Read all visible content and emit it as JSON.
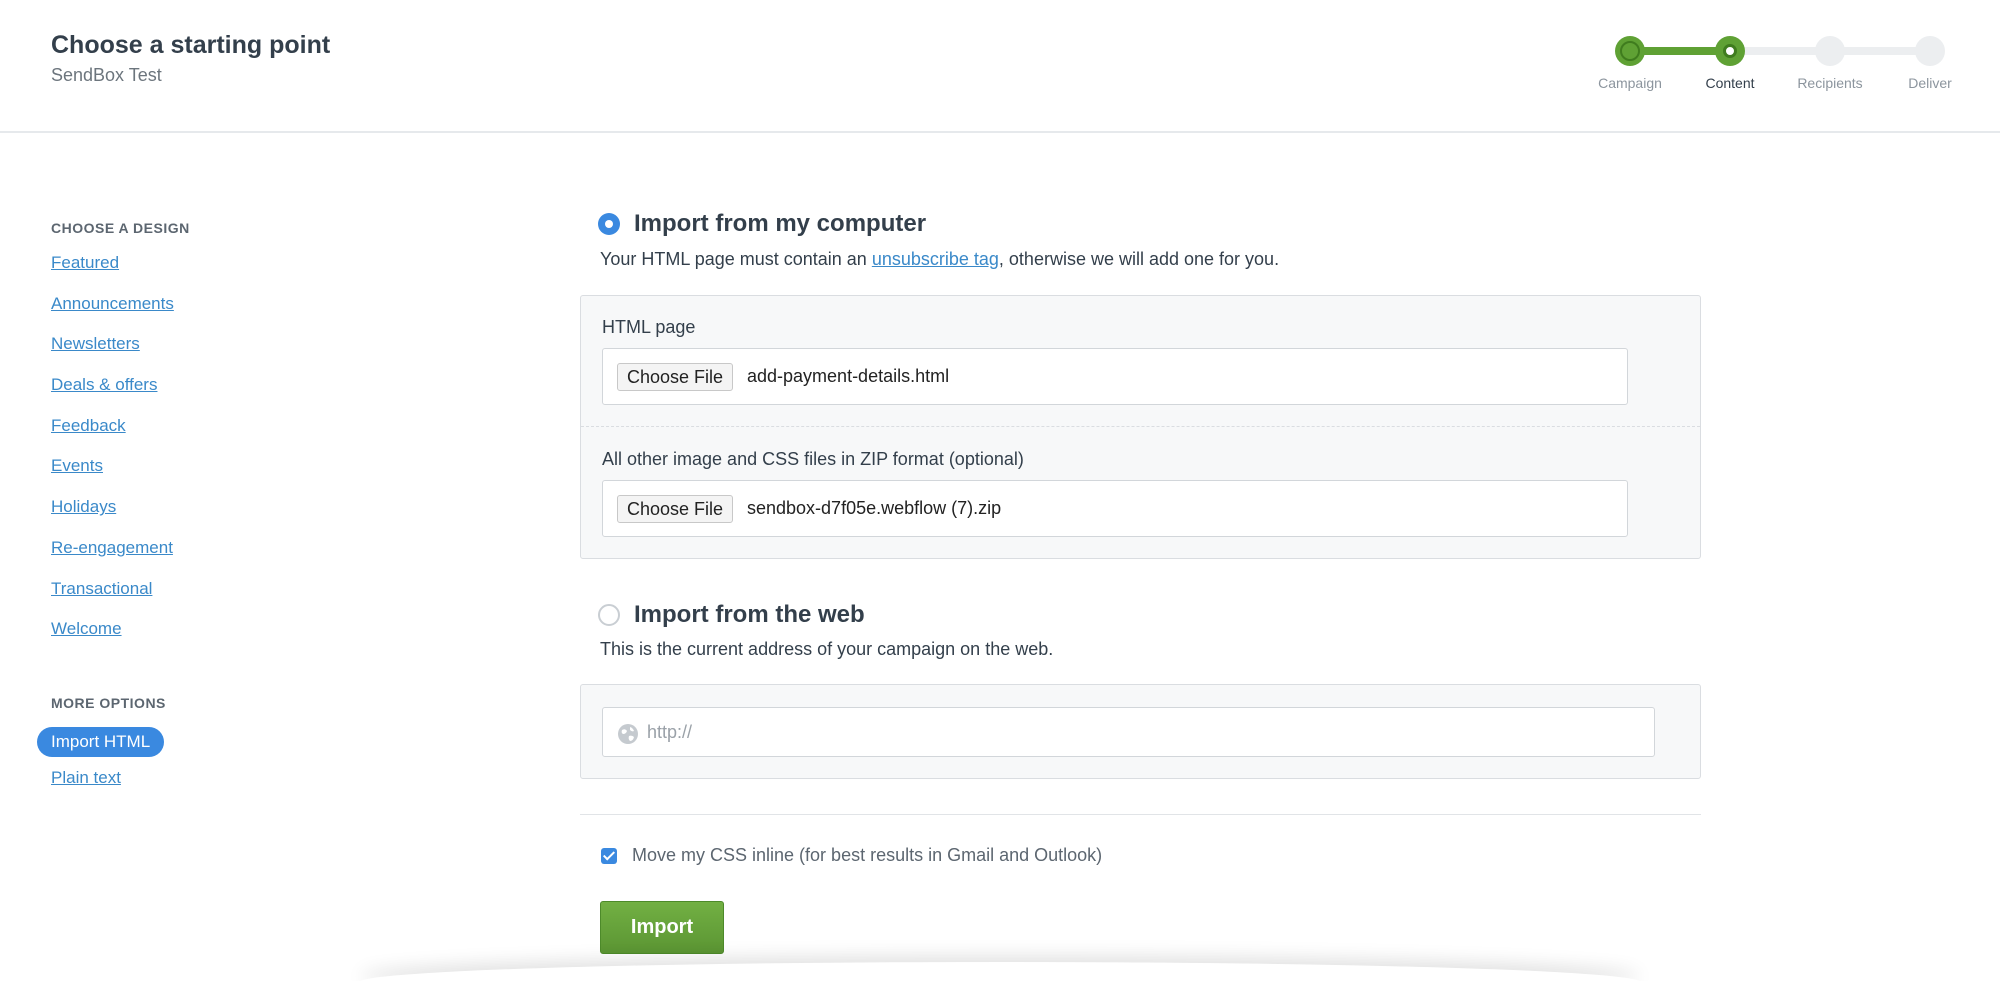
{
  "header": {
    "title": "Choose a starting point",
    "subtitle": "SendBox Test"
  },
  "steps": [
    {
      "label": "Campaign",
      "state": "done"
    },
    {
      "label": "Content",
      "state": "current"
    },
    {
      "label": "Recipients",
      "state": "todo"
    },
    {
      "label": "Deliver",
      "state": "todo"
    }
  ],
  "colors": {
    "accent": "#3a89e0",
    "progress": "#5fa134",
    "link": "#3a89c9"
  },
  "sidebar": {
    "design_heading": "CHOOSE A DESIGN",
    "design_items": [
      {
        "label": "Featured"
      },
      {
        "label": "Announcements"
      },
      {
        "label": "Newsletters"
      },
      {
        "label": "Deals & offers"
      },
      {
        "label": "Feedback"
      },
      {
        "label": "Events"
      },
      {
        "label": "Holidays"
      },
      {
        "label": "Re-engagement"
      },
      {
        "label": "Transactional"
      },
      {
        "label": "Welcome"
      }
    ],
    "more_heading": "MORE OPTIONS",
    "more_items": [
      {
        "label": "Import HTML",
        "selected": true
      },
      {
        "label": "Plain text",
        "selected": false
      }
    ]
  },
  "import_computer": {
    "title": "Import from my computer",
    "desc_before": "Your HTML page must contain an ",
    "desc_link": "unsubscribe tag",
    "desc_after": ", otherwise we will add one for you.",
    "html_label": "HTML page",
    "html_button": "Choose File",
    "html_file": "add-payment-details.html",
    "zip_label": "All other image and CSS files in ZIP format (optional)",
    "zip_button": "Choose File",
    "zip_file": "sendbox-d7f05e.webflow (7).zip"
  },
  "import_web": {
    "title": "Import from the web",
    "desc": "This is the current address of your campaign on the web.",
    "url_placeholder": "http://"
  },
  "options": {
    "inline_css_label": "Move my CSS inline (for best results in Gmail and Outlook)",
    "inline_css_checked": true
  },
  "import_button": "Import"
}
